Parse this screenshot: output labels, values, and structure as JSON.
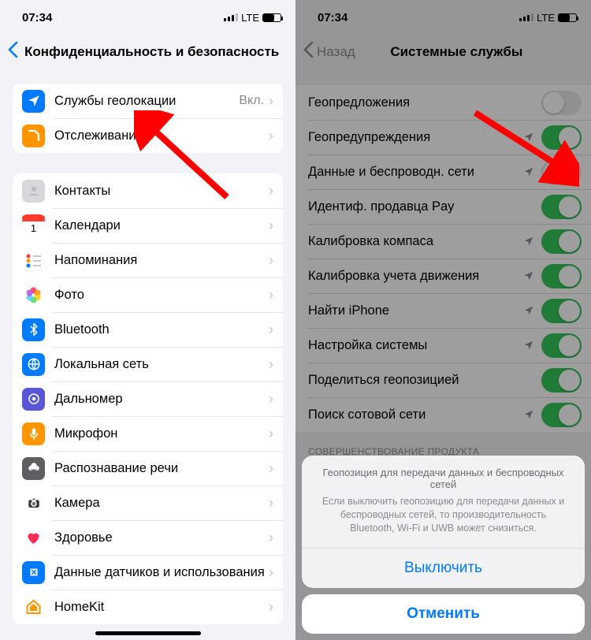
{
  "status": {
    "time": "07:34",
    "net": "LTE"
  },
  "left": {
    "title": "Конфиденциальность и безопасность",
    "group1": [
      {
        "icon": "location",
        "label": "Службы геолокации",
        "value": "Вкл.",
        "color": "#007aff"
      },
      {
        "icon": "tracking",
        "label": "Отслеживание",
        "value": "",
        "color": "#ff9500"
      }
    ],
    "group2": [
      {
        "icon": "contacts",
        "label": "Контакты",
        "color": "#d8d8dc"
      },
      {
        "icon": "calendar",
        "label": "Календари",
        "color": "#ffffff"
      },
      {
        "icon": "reminders",
        "label": "Напоминания",
        "color": "#ffffff"
      },
      {
        "icon": "photos",
        "label": "Фото",
        "color": "#ffffff"
      },
      {
        "icon": "bluetooth",
        "label": "Bluetooth",
        "color": "#007aff"
      },
      {
        "icon": "localnet",
        "label": "Локальная сеть",
        "color": "#007aff"
      },
      {
        "icon": "rangefind",
        "label": "Дальномер",
        "color": "#5856d6"
      },
      {
        "icon": "mic",
        "label": "Микрофон",
        "color": "#ff9500"
      },
      {
        "icon": "speech",
        "label": "Распознавание речи",
        "color": "#5f5f63"
      },
      {
        "icon": "camera",
        "label": "Камера",
        "color": "#8e8e93"
      },
      {
        "icon": "health",
        "label": "Здоровье",
        "color": "#ffffff"
      },
      {
        "icon": "sensors",
        "label": "Данные датчиков и использования",
        "color": "#007aff"
      },
      {
        "icon": "homekit",
        "label": "HomeKit",
        "color": "#ffffff"
      }
    ]
  },
  "right": {
    "back": "Назад",
    "title": "Системные службы",
    "items": [
      {
        "label": "Геопредложения",
        "on": false,
        "arrow": false
      },
      {
        "label": "Геопредупреждения",
        "on": true,
        "arrow": true
      },
      {
        "label": "Данные и беспроводн. сети",
        "on": false,
        "arrow": true
      },
      {
        "label": "Идентиф. продавца Pay",
        "on": true,
        "arrow": false
      },
      {
        "label": "Калибровка компаса",
        "on": true,
        "arrow": true
      },
      {
        "label": "Калибровка учета движения",
        "on": true,
        "arrow": true
      },
      {
        "label": "Найти iPhone",
        "on": true,
        "arrow": true
      },
      {
        "label": "Настройка системы",
        "on": true,
        "arrow": true
      },
      {
        "label": "Поделиться геопозицией",
        "on": true,
        "arrow": false
      },
      {
        "label": "Поиск сотовой сети",
        "on": true,
        "arrow": true
      }
    ],
    "footer": "СОВЕРШЕНСТВОВАНИЕ ПРОДУКТА",
    "sheet": {
      "title": "Геопозиция для передачи данных и беспроводных сетей",
      "desc": "Если выключить геопозицию для передачи данных и беспроводных сетей, то производительность Bluetooth, Wi-Fi и UWB может снизиться.",
      "action": "Выключить",
      "cancel": "Отменить"
    }
  }
}
